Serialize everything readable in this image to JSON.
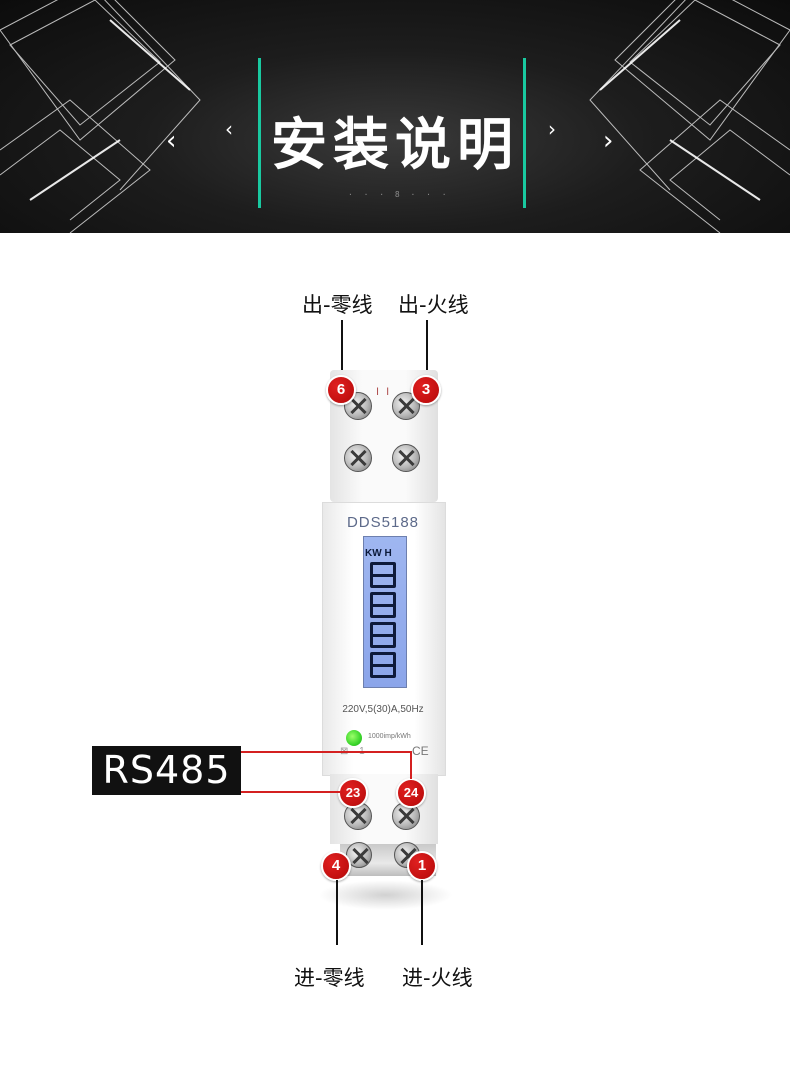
{
  "header": {
    "title": "安装说明",
    "chevron_left": "‹",
    "chevron_right": "›",
    "tiny_text": "· · · 8 · · ·",
    "accent_color": "#19c9a0"
  },
  "labels": {
    "out_neutral": "出-零线",
    "out_live": "出-火线",
    "in_neutral": "进-零线",
    "in_live": "进-火线"
  },
  "meter": {
    "model": "DDS5188",
    "lcd_unit": "KW H",
    "spec": "220V,5(30)A,50Hz",
    "impulse": "1000imp/kWh",
    "ce_mark": "CE",
    "top_marks": "I I",
    "bottom_marks": "⊠ 1",
    "lcd_color": "#8ba5ea",
    "led_color": "#3bd62b"
  },
  "terminals": {
    "t6": "6",
    "t3": "3",
    "t23": "23",
    "t24": "24",
    "t4": "4",
    "t1": "1"
  },
  "rs485": {
    "label": "RS485",
    "line_color": "#d42020"
  }
}
